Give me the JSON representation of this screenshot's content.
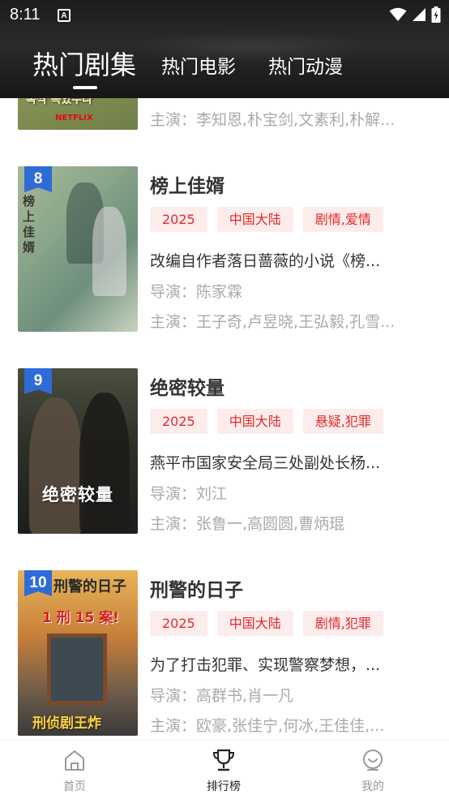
{
  "status_bar": {
    "time": "8:11",
    "app_icon_letter": "A"
  },
  "tabs": [
    {
      "label": "热门剧集",
      "active": true
    },
    {
      "label": "热门电影",
      "active": false
    },
    {
      "label": "热门动漫",
      "active": false
    }
  ],
  "colors": {
    "accent": "#e22a2a",
    "tag_bg": "#fdecec",
    "rank_badge": "#2f6bd6",
    "header_bg": "#1e1e1e"
  },
  "list": {
    "partial_item": {
      "cast": "主演：李知恩,朴宝剑,文素利,朴解...",
      "poster_text": "폭싹 속았수다",
      "poster_brand": "NETFLIX"
    },
    "items": [
      {
        "rank": "8",
        "title": "榜上佳婿",
        "tags": [
          "2025",
          "中国大陆",
          "剧情,爱情"
        ],
        "description": "改编自作者落日蔷薇的小说《榜...",
        "director": "导演：陈家霖",
        "cast": "主演：王子奇,卢昱晓,王弘毅,孔雪...",
        "poster_text": "榜上佳婿"
      },
      {
        "rank": "9",
        "title": "绝密较量",
        "tags": [
          "2025",
          "中国大陆",
          "悬疑,犯罪"
        ],
        "description": "燕平市国家安全局三处副处长杨...",
        "director": "导演：刘江",
        "cast": "主演：张鲁一,高圆圆,曹炳琨",
        "poster_text": "绝密较量"
      },
      {
        "rank": "10",
        "title": "刑警的日子",
        "tags": [
          "2025",
          "中国大陆",
          "剧情,犯罪"
        ],
        "description": "为了打击犯罪、实现警察梦想，...",
        "director": "导演：高群书,肖一凡",
        "cast": "主演：欧豪,张佳宁,何冰,王佳佳,...",
        "poster_text": "刑警的日子",
        "poster_subtext": "1 刑 15 案!",
        "poster_bottom": "刑侦剧王炸"
      }
    ]
  },
  "bottom_nav": [
    {
      "label": "首页",
      "icon": "home-icon",
      "active": false
    },
    {
      "label": "排行榜",
      "icon": "trophy-icon",
      "active": true
    },
    {
      "label": "我的",
      "icon": "profile-icon",
      "active": false
    }
  ]
}
